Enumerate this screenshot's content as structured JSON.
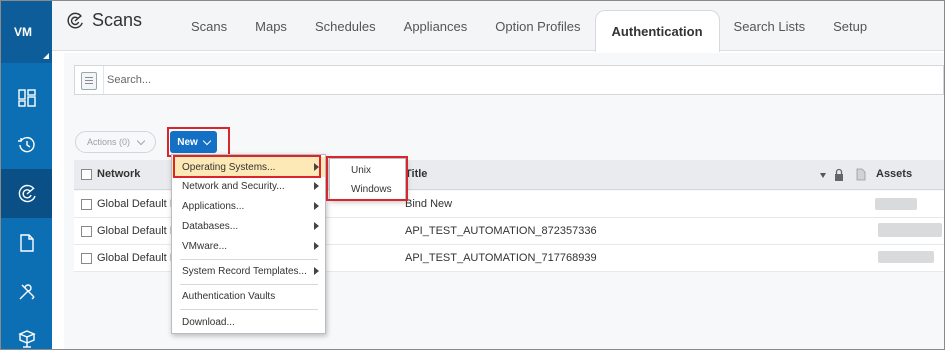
{
  "rail": {
    "logo": "VM",
    "items": [
      {
        "icon": "dashboard-icon"
      },
      {
        "icon": "history-icon"
      },
      {
        "icon": "scans-radar-icon",
        "active": true
      },
      {
        "icon": "document-icon"
      },
      {
        "icon": "tools-icon"
      },
      {
        "icon": "network-icon"
      }
    ]
  },
  "header": {
    "app_title": "Scans",
    "tabs": [
      "Scans",
      "Maps",
      "Schedules",
      "Appliances",
      "Option Profiles",
      "Authentication",
      "Search Lists",
      "Setup"
    ],
    "active_tab": "Authentication"
  },
  "search": {
    "placeholder": "Search..."
  },
  "toolbar": {
    "actions_label": "Actions (0)",
    "new_label": "New"
  },
  "table": {
    "columns": {
      "network": "Network",
      "title": "Title",
      "assets": "Assets"
    },
    "rows": [
      {
        "network": "Global Default I",
        "title": "Bind New"
      },
      {
        "network": "Global Default I",
        "title": "API_TEST_AUTOMATION_872357336"
      },
      {
        "network": "Global Default I",
        "title": "API_TEST_AUTOMATION_717768939"
      }
    ]
  },
  "new_menu": {
    "items": [
      {
        "label": "Operating Systems...",
        "submenu": true,
        "highlighted": true
      },
      {
        "label": "Network and Security...",
        "submenu": true
      },
      {
        "label": "Applications...",
        "submenu": true
      },
      {
        "label": "Databases...",
        "submenu": true
      },
      {
        "label": "VMware...",
        "submenu": true
      },
      {
        "label": "System Record Templates...",
        "submenu": true
      },
      {
        "label": "Authentication Vaults",
        "submenu": false
      },
      {
        "label": "Download...",
        "submenu": false
      }
    ]
  },
  "os_submenu": {
    "items": [
      "Unix",
      "Windows"
    ]
  },
  "colors": {
    "rail": "#0d6fb3",
    "rail_active": "#0a4f85",
    "primary_button": "#1470c4",
    "highlight_outline": "#d9262c",
    "menu_hover": "#fde9b6"
  }
}
